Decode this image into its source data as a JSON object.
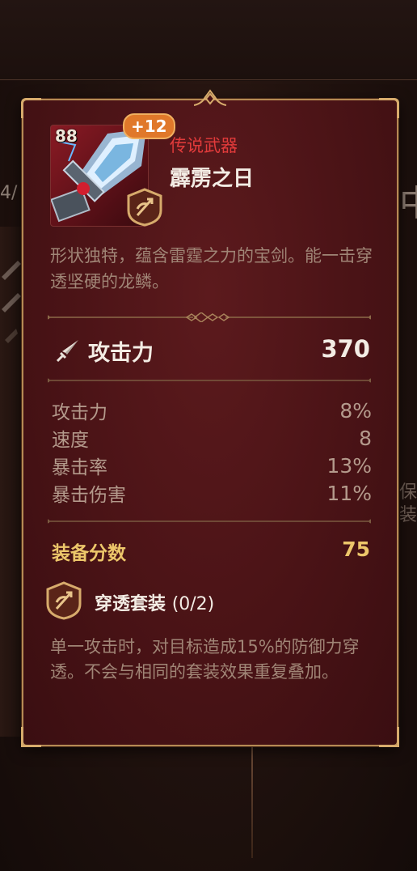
{
  "item": {
    "rarity": "传说武器",
    "name": "霹雳之日",
    "level": "88",
    "enhance": "+12",
    "description": "形状独特，蕴含雷霆之力的宝剑。能一击穿透坚硬的龙鳞。"
  },
  "main_stat": {
    "label": "攻击力",
    "value": "370",
    "icon": "sword-icon"
  },
  "sub_stats": [
    {
      "label": "攻击力",
      "value": "8%"
    },
    {
      "label": "速度",
      "value": "8"
    },
    {
      "label": "暴击率",
      "value": "13%"
    },
    {
      "label": "暴击伤害",
      "value": "11%"
    }
  ],
  "score": {
    "label": "装备分数",
    "value": "75"
  },
  "set": {
    "name": "穿透套装",
    "count": "(0/2)",
    "icon": "penetration-set-icon",
    "description": "单一攻击时，对目标造成15%的防御力穿透。不会与相同的套装效果重复叠加。"
  },
  "background": {
    "left_fragment": "4/",
    "right_glyph": "中",
    "right_text_1": "保",
    "right_text_2": "装"
  },
  "colors": {
    "panel_bg": "#4a1316",
    "border_gold": "#b58a54",
    "rarity_red": "#e23b3b",
    "score_gold": "#ecc66a",
    "enhance_orange": "#e0782a"
  }
}
